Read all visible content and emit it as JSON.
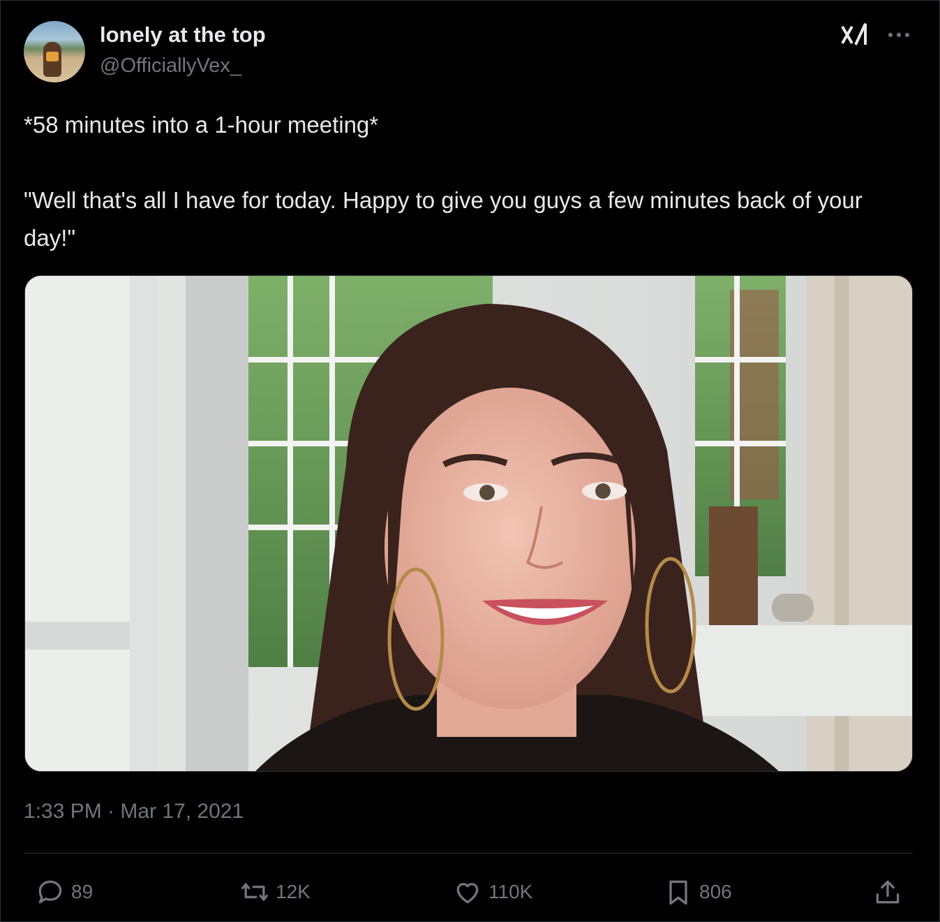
{
  "author": {
    "display_name": "lonely at the top",
    "handle": "@OfficiallyVex_"
  },
  "tweet": {
    "line1": "*58 minutes into a 1-hour meeting*",
    "line2": "\"Well that's all I have for today. Happy to give you guys a few minutes back of your day!\""
  },
  "meta": {
    "timestamp": "1:33 PM · Mar 17, 2021"
  },
  "actions": {
    "replies": "89",
    "reposts": "12K",
    "likes": "110K",
    "bookmarks": "806"
  },
  "icons": [
    "grok-icon",
    "more-icon",
    "reply-icon",
    "repost-icon",
    "like-icon",
    "bookmark-icon",
    "share-icon"
  ],
  "colors": {
    "background": "#000000",
    "text": "#e7e9ea",
    "muted": "#71767b",
    "border": "#2f3336"
  }
}
